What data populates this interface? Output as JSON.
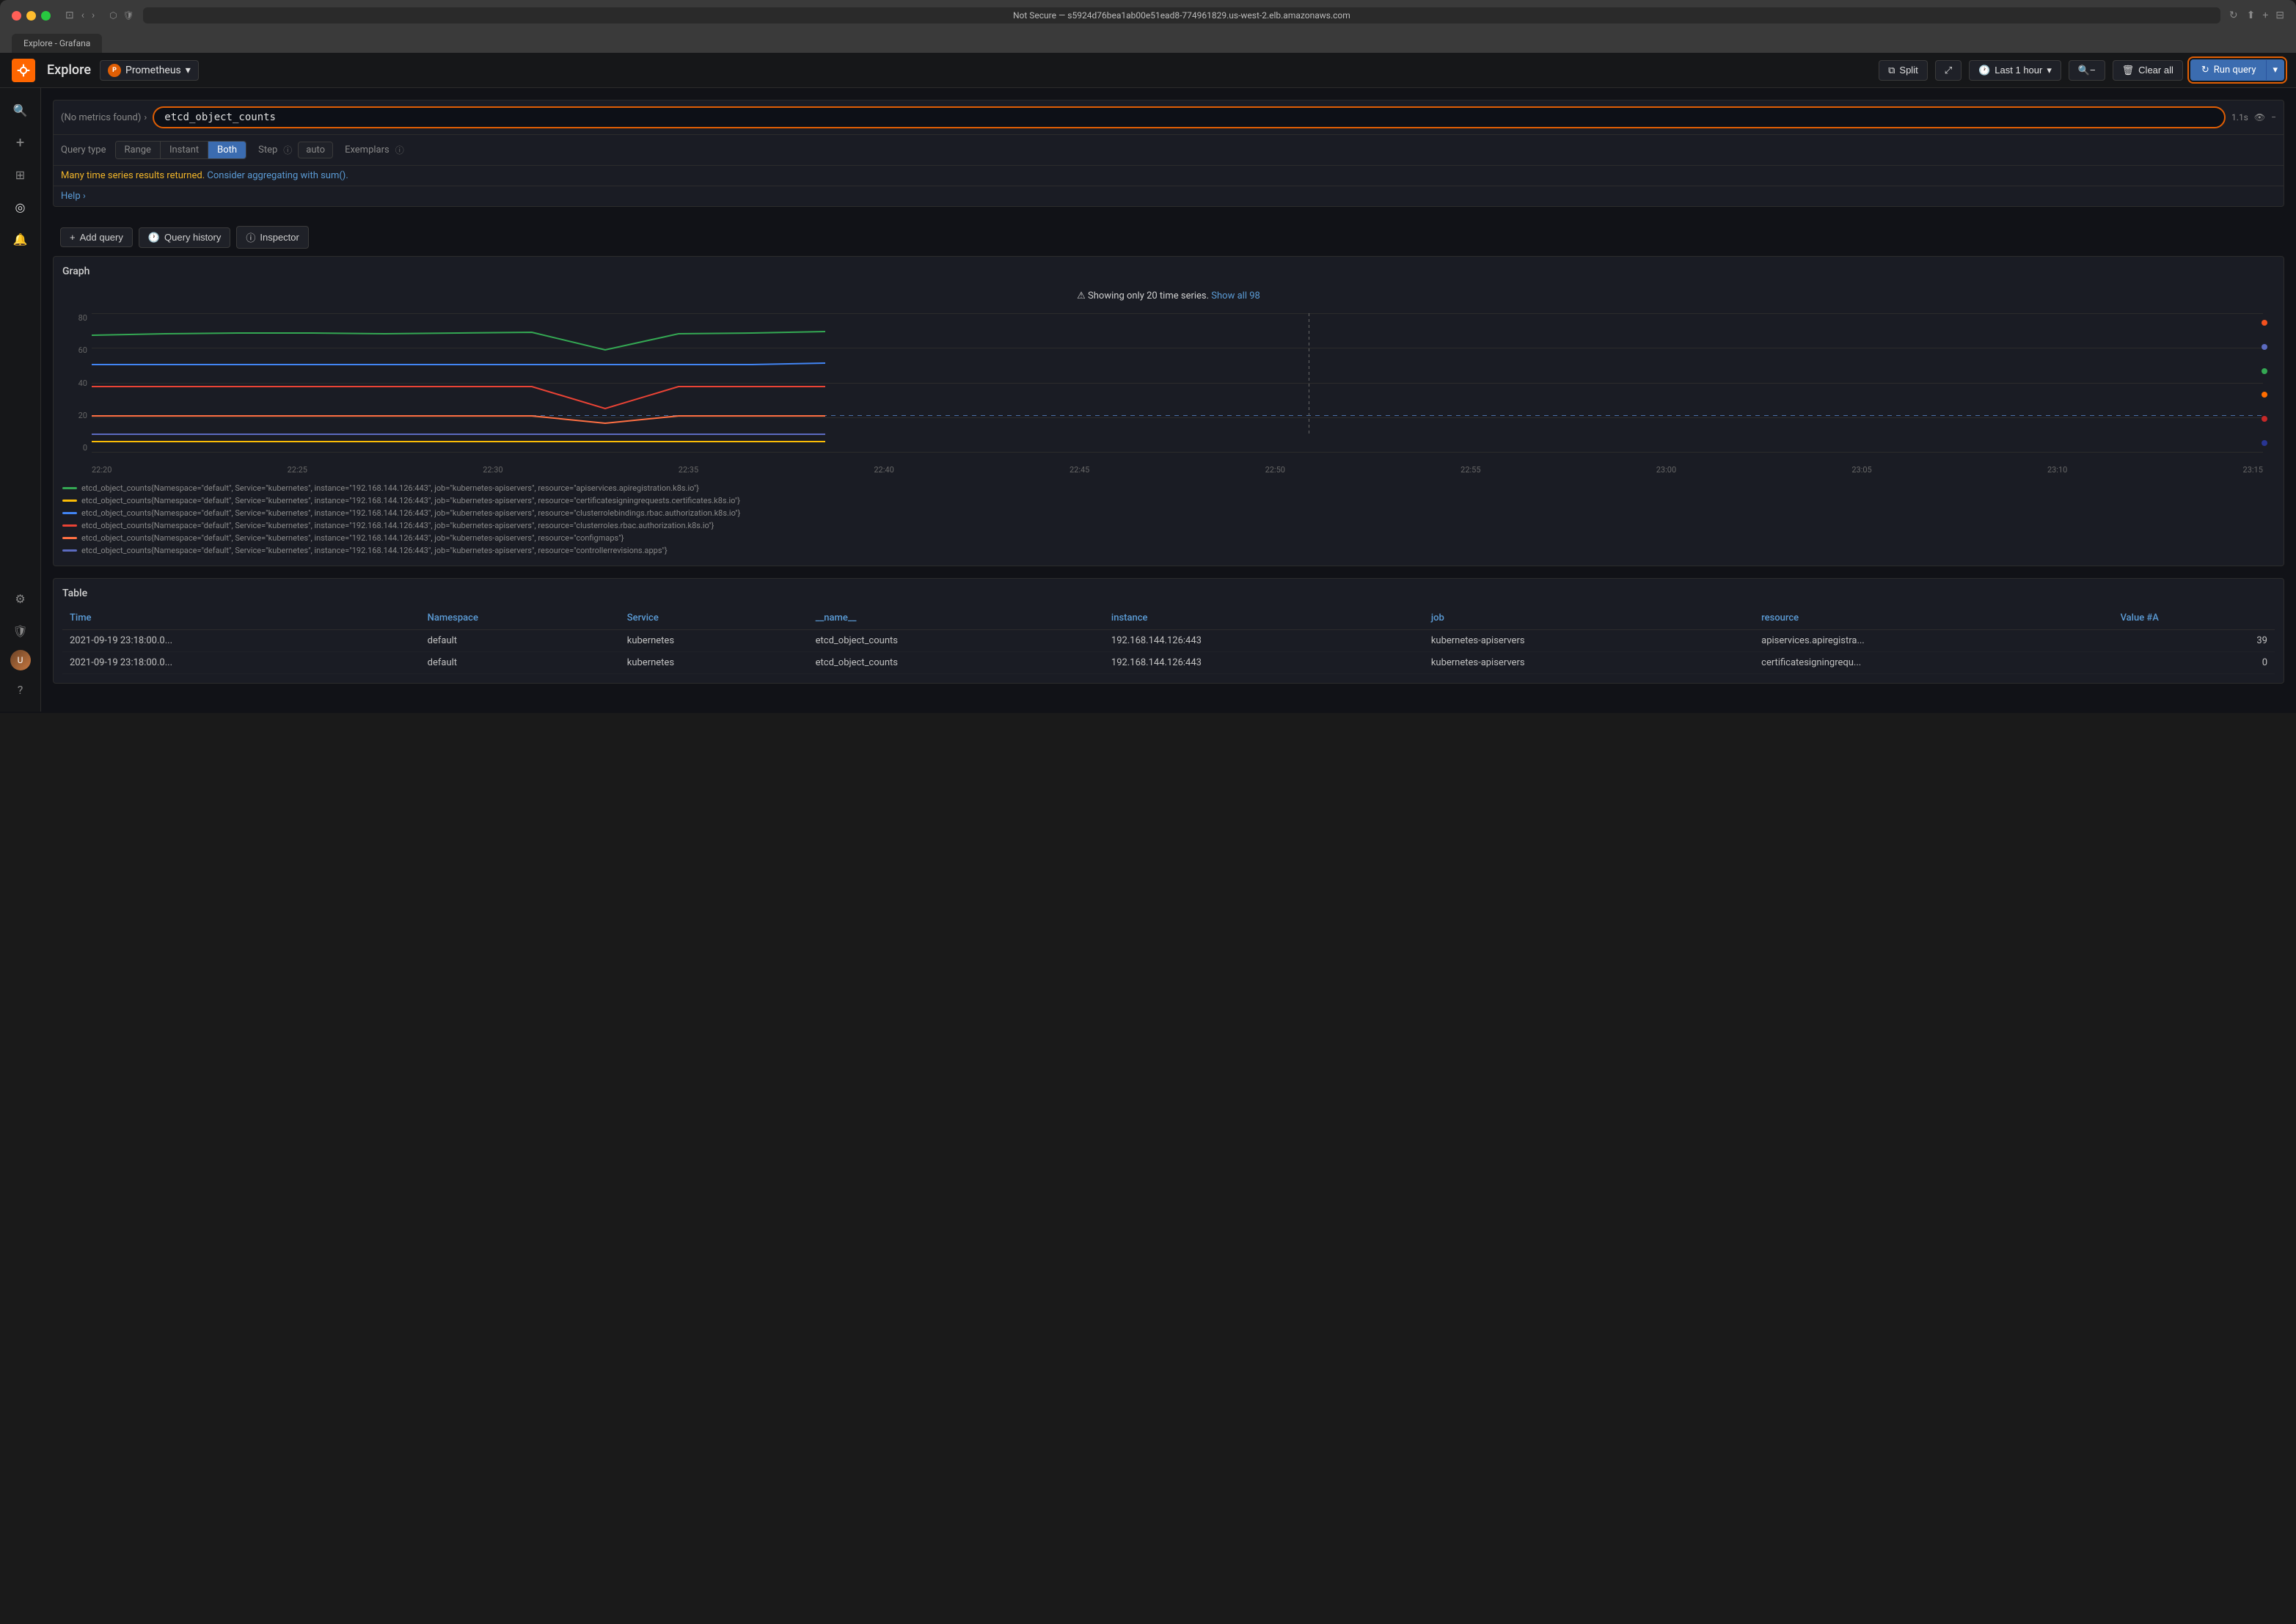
{
  "browser": {
    "traffic_lights": [
      "red",
      "yellow",
      "green"
    ],
    "address": "Not Secure — s5924d76bea1ab00e51ead8-774961829.us-west-2.elb.amazonaws.com",
    "tab_label": "Explore - Grafana"
  },
  "topbar": {
    "logo_letter": "",
    "explore_label": "Explore",
    "datasource_name": "Prometheus",
    "split_label": "Split",
    "time_label": "Last 1 hour",
    "clear_label": "Clear all",
    "run_label": "Run query"
  },
  "sidebar": {
    "icons": [
      {
        "name": "search-icon",
        "glyph": "🔍"
      },
      {
        "name": "plus-icon",
        "glyph": "+"
      },
      {
        "name": "grid-icon",
        "glyph": "⊞"
      },
      {
        "name": "compass-icon",
        "glyph": "◎"
      },
      {
        "name": "bell-icon",
        "glyph": "🔔"
      },
      {
        "name": "gear-icon",
        "glyph": "⚙"
      },
      {
        "name": "shield-icon",
        "glyph": "🛡"
      }
    ],
    "avatar_initials": "U"
  },
  "query_editor": {
    "metrics_breadcrumb": "(No metrics found)",
    "query_value": "etcd_object_counts",
    "query_time": "1.1s",
    "query_type_label": "Query type",
    "tabs": [
      {
        "label": "Range",
        "active": false
      },
      {
        "label": "Instant",
        "active": false
      },
      {
        "label": "Both",
        "active": true
      }
    ],
    "step_label": "Step",
    "step_value": "auto",
    "exemplars_label": "Exemplars",
    "warning_text": "Many time series results returned.",
    "warning_link": "Consider aggregating with sum().",
    "help_text": "Help ›"
  },
  "action_buttons": {
    "add_query": "+ Add query",
    "query_history": "Query history",
    "inspector": "Inspector"
  },
  "graph": {
    "title": "Graph",
    "warning": "⚠ Showing only 20 time series.",
    "show_all_link": "Show all 98",
    "y_labels": [
      "80",
      "60",
      "40",
      "20",
      "0"
    ],
    "x_labels": [
      "22:20",
      "22:25",
      "22:30",
      "22:35",
      "22:40",
      "22:45",
      "22:50",
      "22:55",
      "23:00",
      "23:05",
      "23:10",
      "23:15"
    ],
    "legend_items": [
      {
        "color": "#34a853",
        "label": "etcd_object_counts{Namespace=\"default\", Service=\"kubernetes\", instance=\"192.168.144.126:443\", job=\"kubernetes-apiservers\", resource=\"apiservices.apiregistration.k8s.io\"}"
      },
      {
        "color": "#fbbc05",
        "label": "etcd_object_counts{Namespace=\"default\", Service=\"kubernetes\", instance=\"192.168.144.126:443\", job=\"kubernetes-apiservers\", resource=\"certificatesigningrequests.certificates.k8s.io\"}"
      },
      {
        "color": "#4285f4",
        "label": "etcd_object_counts{Namespace=\"default\", Service=\"kubernetes\", instance=\"192.168.144.126:443\", job=\"kubernetes-apiservers\", resource=\"clusterrolebindings.rbac.authorization.k8s.io\"}"
      },
      {
        "color": "#ea4335",
        "label": "etcd_object_counts{Namespace=\"default\", Service=\"kubernetes\", instance=\"192.168.144.126:443\", job=\"kubernetes-apiservers\", resource=\"clusterroles.rbac.authorization.k8s.io\"}"
      },
      {
        "color": "#ff7043",
        "label": "etcd_object_counts{Namespace=\"default\", Service=\"kubernetes\", instance=\"192.168.144.126:443\", job=\"kubernetes-apiservers\", resource=\"configmaps\"}"
      },
      {
        "color": "#5c6bc0",
        "label": "etcd_object_counts{Namespace=\"default\", Service=\"kubernetes\", instance=\"192.168.144.126:443\", job=\"kubernetes-apiservers\", resource=\"controllerrevisions.apps\"}"
      }
    ],
    "right_dots_colors": [
      "#f4511e",
      "#5c6bc0",
      "#34a853",
      "#ff6d00",
      "#c62828",
      "#283593"
    ]
  },
  "table": {
    "title": "Table",
    "columns": [
      "Time",
      "Namespace",
      "Service",
      "__name__",
      "instance",
      "job",
      "resource",
      "Value #A"
    ],
    "rows": [
      [
        "2021-09-19 23:18:00.0...",
        "default",
        "kubernetes",
        "etcd_object_counts",
        "192.168.144.126:443",
        "kubernetes-apiservers",
        "apiservices.apiregistra...",
        "39"
      ],
      [
        "2021-09-19 23:18:00.0...",
        "default",
        "kubernetes",
        "etcd_object_counts",
        "192.168.144.126:443",
        "kubernetes-apiservers",
        "certificatesigningrequ...",
        "0"
      ]
    ]
  }
}
